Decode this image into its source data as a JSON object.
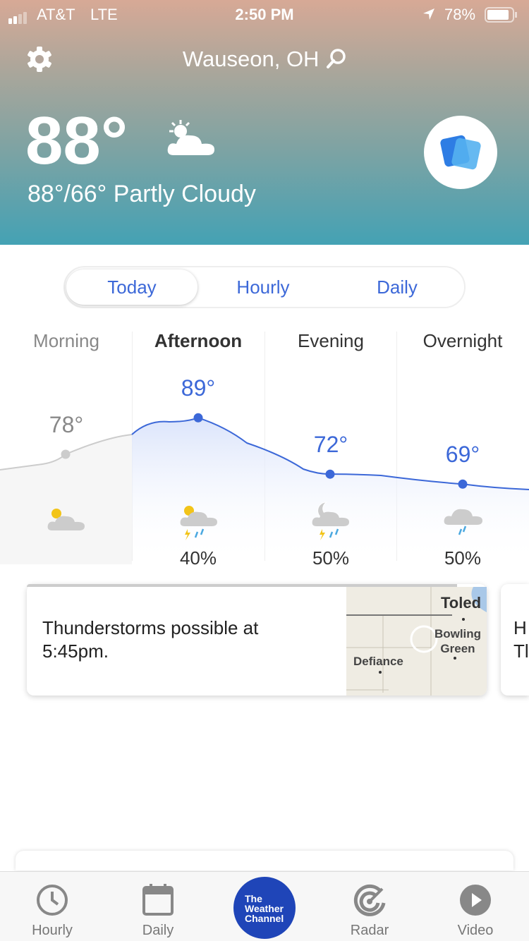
{
  "status": {
    "carrier": "AT&T",
    "network": "LTE",
    "time": "2:50 PM",
    "battery": "78%"
  },
  "header": {
    "location": "Wauseon, OH",
    "temperature": "88°",
    "summary": "88°/66° Partly Cloudy",
    "condition_icon": "partly-cloudy-icon"
  },
  "tabs": [
    {
      "label": "Today",
      "active": true
    },
    {
      "label": "Hourly"
    },
    {
      "label": "Daily"
    }
  ],
  "periods": [
    {
      "label": "Morning",
      "temp": "78°",
      "temp_value": 78,
      "precip": "",
      "icon": "partly-cloudy-icon",
      "past": true
    },
    {
      "label": "Afternoon",
      "temp": "89°",
      "temp_value": 89,
      "precip": "40%",
      "icon": "thunderstorm-sun-icon",
      "current": true
    },
    {
      "label": "Evening",
      "temp": "72°",
      "temp_value": 72,
      "precip": "50%",
      "icon": "thunderstorm-moon-icon"
    },
    {
      "label": "Overnight",
      "temp": "69°",
      "temp_value": 69,
      "precip": "50%",
      "icon": "rain-icon"
    }
  ],
  "alert_card": {
    "text": "Thunderstorms possible at 5:45pm.",
    "map_labels": [
      "Toled",
      "Bowling Green",
      "Defiance"
    ]
  },
  "next_card": {
    "text": "H\nTl"
  },
  "colors": {
    "accent": "#3c68d8",
    "nav_brand": "#1f45b8"
  },
  "nav": [
    {
      "label": "Hourly"
    },
    {
      "label": "Daily"
    },
    {
      "label": "The Weather Channel"
    },
    {
      "label": "Radar"
    },
    {
      "label": "Video"
    }
  ]
}
